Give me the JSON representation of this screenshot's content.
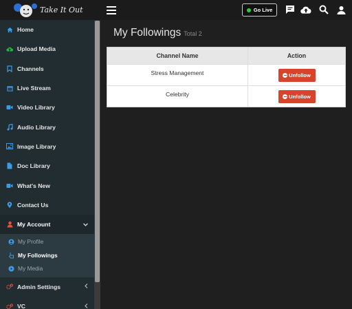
{
  "brand": {
    "logo_text": "Take It Out"
  },
  "sidebar": {
    "items": [
      {
        "label": "Home",
        "icon": "home-icon",
        "color": "#3c9be6"
      },
      {
        "label": "Upload Media",
        "icon": "cloud-upload-icon",
        "color": "#21ba45"
      },
      {
        "label": "Channels",
        "icon": "bookmark-icon",
        "color": "#3c9be6"
      },
      {
        "label": "Live Stream",
        "icon": "calendar-icon",
        "color": "#3c9be6"
      },
      {
        "label": "Video Library",
        "icon": "video-icon",
        "color": "#3c9be6"
      },
      {
        "label": "Audio Library",
        "icon": "music-icon",
        "color": "#3c9be6"
      },
      {
        "label": "Image Library",
        "icon": "image-icon",
        "color": "#3c9be6"
      },
      {
        "label": "Doc Library",
        "icon": "document-icon",
        "color": "#3c9be6"
      },
      {
        "label": "What's New",
        "icon": "video-icon",
        "color": "#3c9be6"
      },
      {
        "label": "Contact Us",
        "icon": "map-pin-icon",
        "color": "#3c9be6"
      }
    ],
    "account": {
      "label": "My Account",
      "icon": "user-icon",
      "color": "#e74c3c",
      "submenu": [
        {
          "label": "My Profile",
          "icon": "user-circle-icon"
        },
        {
          "label": "My Followings",
          "icon": "hand-pointer-icon"
        },
        {
          "label": "My Media",
          "icon": "play-circle-icon"
        }
      ]
    },
    "bottom_items": [
      {
        "label": "Admin Settings",
        "icon": "cogs-icon",
        "color": "#e74c3c"
      },
      {
        "label": "VC",
        "icon": "cogs-icon",
        "color": "#e74c3c"
      }
    ]
  },
  "topbar": {
    "go_live_label": "Go Live",
    "icons": [
      "menu-icon",
      "chat-icon",
      "cloud-upload-icon",
      "search-icon",
      "user-icon"
    ]
  },
  "main": {
    "title": "My Followings",
    "subtitle": "Total 2",
    "table": {
      "columns": [
        "Channel Name",
        "Action"
      ],
      "rows": [
        {
          "channel": "Stress Management",
          "action": "Unfollow"
        },
        {
          "channel": "Celebrity",
          "action": "Unfollow"
        }
      ]
    }
  },
  "colors": {
    "accent_blue": "#3c9be6",
    "danger": "#d9422b",
    "live": "#2ecc40"
  }
}
